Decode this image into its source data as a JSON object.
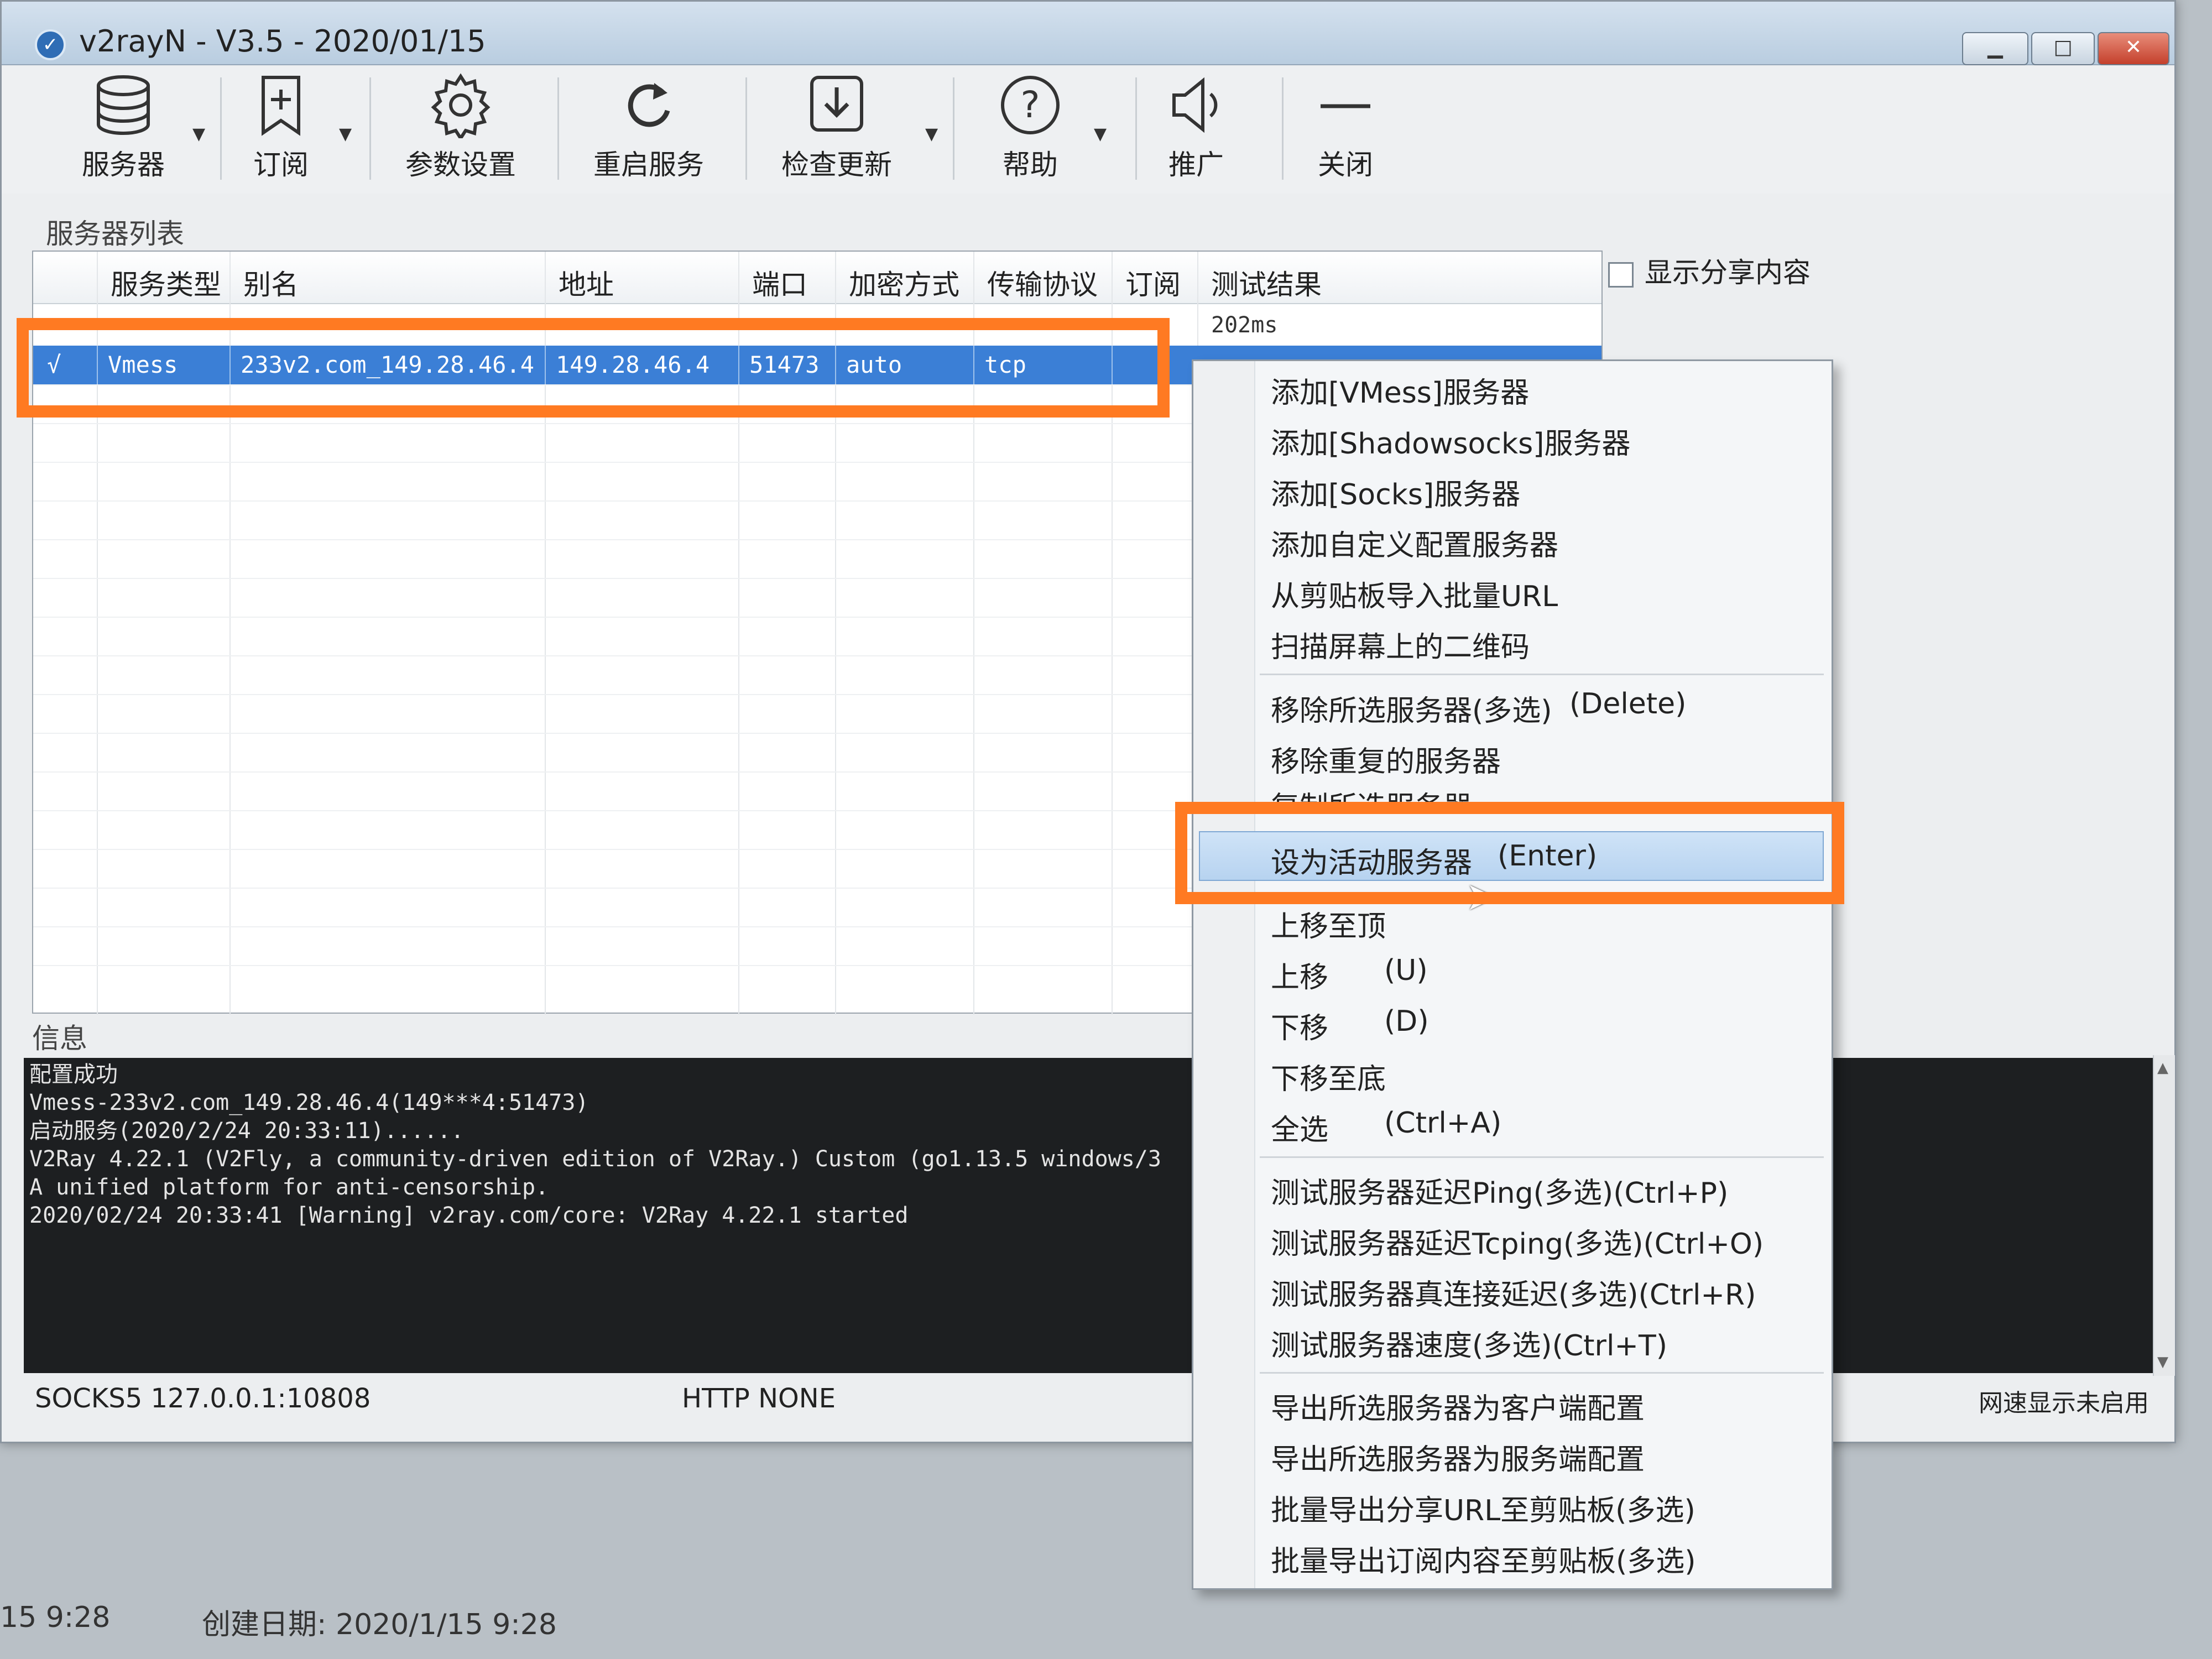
{
  "window": {
    "title": "v2rayN - V3.5 - 2020/01/15"
  },
  "toolbar": {
    "items": [
      {
        "label": "服务器",
        "icon": "database-icon",
        "dropdown": true
      },
      {
        "label": "订阅",
        "icon": "bookmark-add-icon",
        "dropdown": true
      },
      {
        "label": "参数设置",
        "icon": "gear-icon",
        "dropdown": false
      },
      {
        "label": "重启服务",
        "icon": "refresh-icon",
        "dropdown": false
      },
      {
        "label": "检查更新",
        "icon": "download-icon",
        "dropdown": true
      },
      {
        "label": "帮助",
        "icon": "help-icon",
        "dropdown": true
      },
      {
        "label": "推广",
        "icon": "speaker-icon",
        "dropdown": false
      },
      {
        "label": "关闭",
        "icon": "minus-icon",
        "dropdown": false
      }
    ]
  },
  "server_list": {
    "label": "服务器列表",
    "columns": [
      "服务类型",
      "别名",
      "地址",
      "端口",
      "加密方式",
      "传输协议",
      "订阅",
      "测试结果"
    ],
    "ghost_row_result": "202ms",
    "selected_row": {
      "check": "√",
      "type": "Vmess",
      "alias": "233v2.com_149.28.46.4",
      "address": "149.28.46.4",
      "port": "51473",
      "security": "auto",
      "network": "tcp"
    }
  },
  "show_share": {
    "label": "显示分享内容",
    "checked": false
  },
  "info": {
    "label": "信息",
    "lines": [
      "配置成功",
      "Vmess-233v2.com_149.28.46.4(149***4:51473)",
      "启动服务(2020/2/24 20:33:11)......",
      "V2Ray 4.22.1 (V2Fly, a community-driven edition of V2Ray.) Custom (go1.13.5 windows/3",
      "A unified platform for anti-censorship.",
      "2020/02/24 20:33:41 [Warning] v2ray.com/core: V2Ray 4.22.1 started"
    ]
  },
  "status": {
    "socks": "SOCKS5  127.0.0.1:10808",
    "http": "HTTP   NONE",
    "speed": "网速显示未启用"
  },
  "desktop": {
    "left_text": "15 9:28",
    "created": "创建日期: 2020/1/15 9:28"
  },
  "context_menu": {
    "items": [
      {
        "label": "添加[VMess]服务器",
        "shortcut": ""
      },
      {
        "label": "添加[Shadowsocks]服务器",
        "shortcut": ""
      },
      {
        "label": "添加[Socks]服务器",
        "shortcut": ""
      },
      {
        "label": "添加自定义配置服务器",
        "shortcut": ""
      },
      {
        "label": "从剪贴板导入批量URL",
        "shortcut": ""
      },
      {
        "label": "扫描屏幕上的二维码",
        "shortcut": ""
      },
      {
        "label": "移除所选服务器(多选)",
        "shortcut": "(Delete)"
      },
      {
        "label": "移除重复的服务器",
        "shortcut": ""
      },
      {
        "label": "复制所选服务器",
        "shortcut": ""
      },
      {
        "label": "设为活动服务器",
        "shortcut": "(Enter)"
      },
      {
        "label": "上移至顶",
        "shortcut": ""
      },
      {
        "label": "上移",
        "shortcut": "(U)"
      },
      {
        "label": "下移",
        "shortcut": "(D)"
      },
      {
        "label": "下移至底",
        "shortcut": ""
      },
      {
        "label": "全选",
        "shortcut": "(Ctrl+A)"
      },
      {
        "label": "测试服务器延迟Ping(多选)(Ctrl+P)",
        "shortcut": ""
      },
      {
        "label": "测试服务器延迟Tcping(多选)(Ctrl+O)",
        "shortcut": ""
      },
      {
        "label": "测试服务器真连接延迟(多选)(Ctrl+R)",
        "shortcut": ""
      },
      {
        "label": "测试服务器速度(多选)(Ctrl+T)",
        "shortcut": ""
      },
      {
        "label": "导出所选服务器为客户端配置",
        "shortcut": ""
      },
      {
        "label": "导出所选服务器为服务端配置",
        "shortcut": ""
      },
      {
        "label": "批量导出分享URL至剪贴板(多选)",
        "shortcut": ""
      },
      {
        "label": "批量导出订阅内容至剪贴板(多选)",
        "shortcut": ""
      }
    ]
  },
  "colors": {
    "highlight": "#ff7a22",
    "selection": "#3b7fd6"
  }
}
